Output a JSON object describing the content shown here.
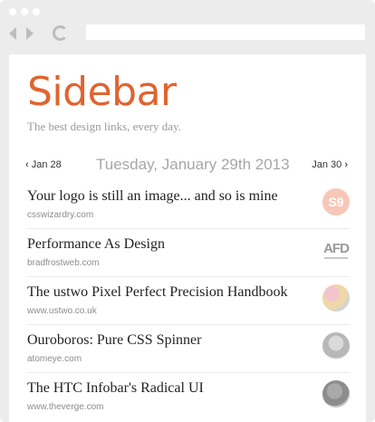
{
  "browser": {
    "address_bar_value": ""
  },
  "site": {
    "logo": "Sidebar",
    "tagline": "The best design links, every day.",
    "brand_color": "#e06430"
  },
  "date_nav": {
    "prev_label": "Jan 28",
    "current_date": "Tuesday, January 29th 2013",
    "next_label": "Jan 30"
  },
  "links": [
    {
      "title": "Your logo is still an image... and so is mine",
      "domain": "csswizardry.com",
      "thumb_icon": "s9-logo",
      "thumb_text": "S9"
    },
    {
      "title": "Performance As Design",
      "domain": "bradfrostweb.com",
      "thumb_icon": "afd-logo",
      "thumb_text": "AFD"
    },
    {
      "title": "The ustwo Pixel Perfect Precision Handbook",
      "domain": "www.ustwo.co.uk",
      "thumb_icon": "avatar-photo"
    },
    {
      "title": "Ouroboros: Pure CSS Spinner",
      "domain": "atomeye.com",
      "thumb_icon": "avatar-photo"
    },
    {
      "title": "The HTC Infobar's Radical UI",
      "domain": "www.theverge.com",
      "thumb_icon": "avatar-photo"
    }
  ]
}
